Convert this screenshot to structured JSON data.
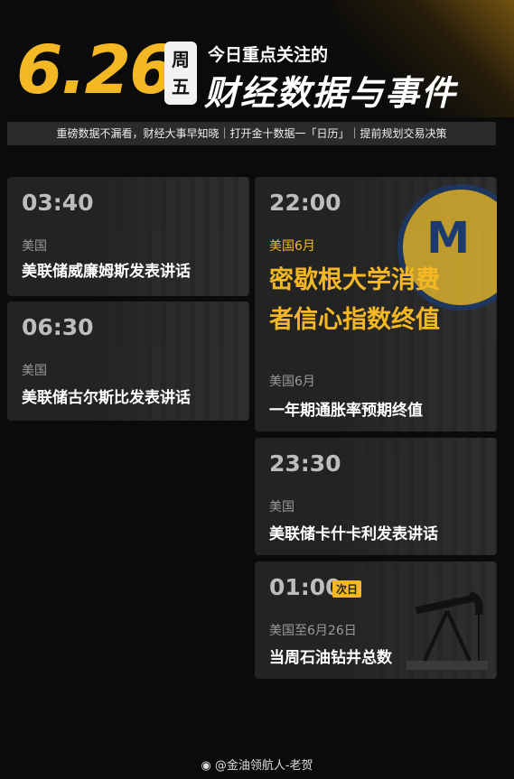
{
  "header": {
    "date": "6.26",
    "weekday_line1": "周",
    "weekday_line2": "五",
    "subhead": "今日重点关注的",
    "headline": "财经数据与事件"
  },
  "banner": "重磅数据不漏看，财经大事早知晓｜打开金十数据一「日历」｜提前规划交易决策",
  "events": [
    {
      "time": "03:40",
      "region": "美国",
      "title": "美联储威廉姆斯发表讲话"
    },
    {
      "time": "06:30",
      "region": "美国",
      "title": "美联储古尔斯比发表讲话"
    },
    {
      "time": "22:00",
      "region": "美国6月",
      "title_line1": "密歇根大学消费",
      "title_line2": "者信心指数终值",
      "sub_region": "美国6月",
      "sub_title": "一年期通胀率预期终值"
    },
    {
      "time": "23:30",
      "region": "美国",
      "title": "美联储卡什卡利发表讲话"
    },
    {
      "time": "01:00",
      "tag": "次日",
      "region": "美国至6月26日",
      "title": "当周石油钻井总数"
    }
  ],
  "footer": "@金油领航人-老贺",
  "colors": {
    "accent": "#f5b825",
    "background": "#0b0b0b",
    "card": "#232323"
  }
}
